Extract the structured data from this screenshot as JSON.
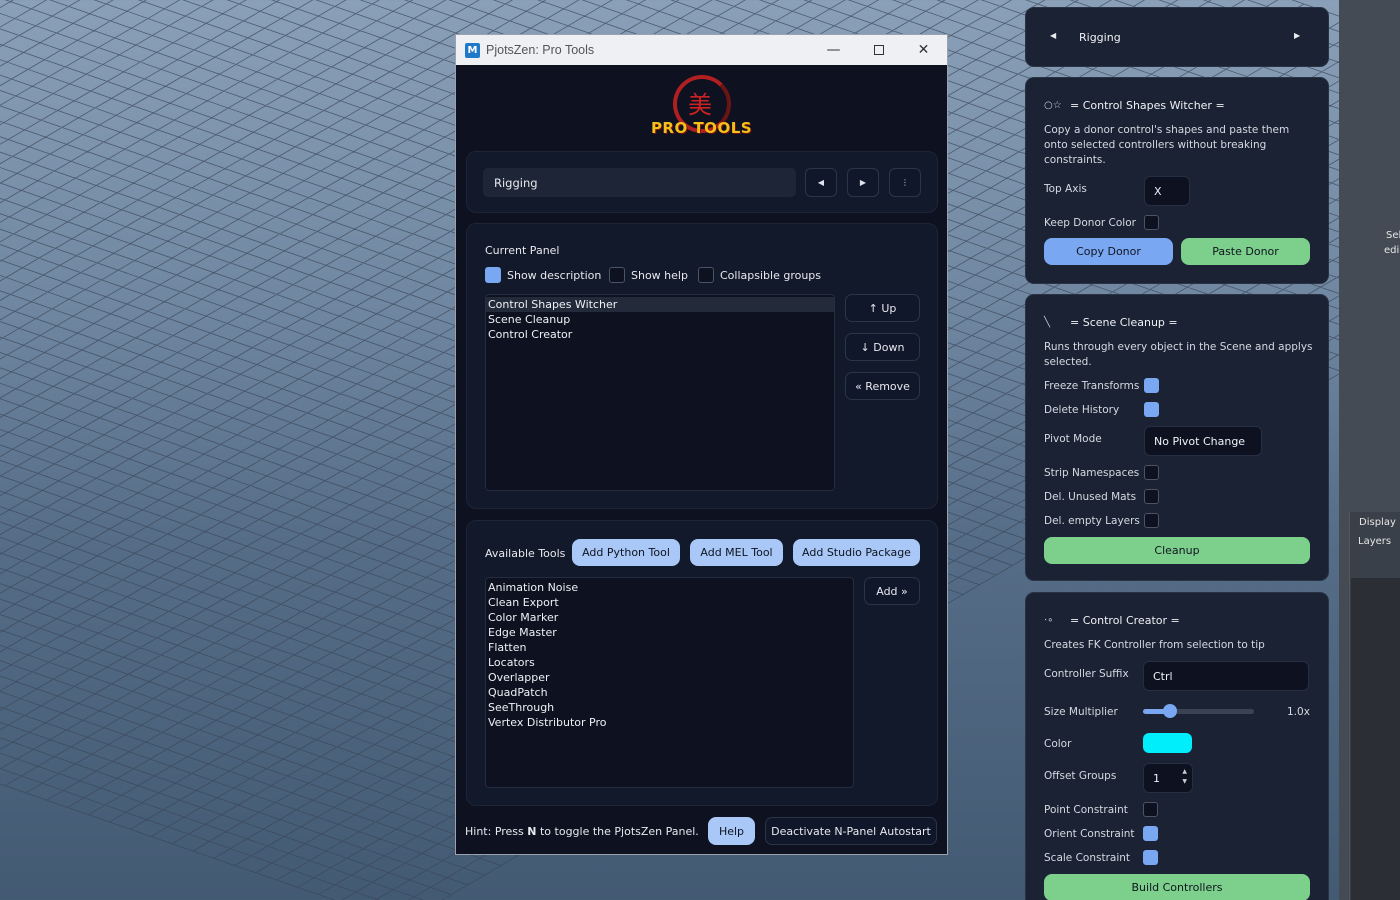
{
  "window": {
    "title": "PjotsZen: Pro Tools",
    "app_icon": "M",
    "logo_text": "PRO TOOLS",
    "logo_glyph": "美"
  },
  "nav": {
    "current": "Rigging"
  },
  "current_panel": {
    "heading": "Current Panel",
    "show_description": {
      "label": "Show description",
      "checked": true
    },
    "show_help": {
      "label": "Show help",
      "checked": false
    },
    "collapsible": {
      "label": "Collapsible groups",
      "checked": false
    },
    "items": [
      "Control Shapes Witcher",
      "Scene Cleanup",
      "Control Creator"
    ],
    "selected": "Control Shapes Witcher",
    "up_label": "↑ Up",
    "down_label": "↓ Down",
    "remove_label": "« Remove"
  },
  "available_tools": {
    "heading": "Available Tools",
    "add_python": "Add Python Tool",
    "add_mel": "Add MEL Tool",
    "add_studio": "Add Studio Package",
    "add_label": "Add »",
    "items": [
      "Animation Noise",
      "Clean Export",
      "Color Marker",
      "Edge Master",
      "Flatten",
      "Locators",
      "Overlapper",
      "QuadPatch",
      "SeeThrough",
      "Vertex Distributor Pro"
    ]
  },
  "footer": {
    "hint_prefix": "Hint: Press ",
    "hint_key": "N",
    "hint_suffix": " to toggle the PjotsZen Panel.",
    "help_label": "Help",
    "deactivate_label": "Deactivate N-Panel Autostart"
  },
  "npanel": {
    "nav_title": "Rigging",
    "csw": {
      "title": "= Control Shapes Witcher =",
      "desc": "Copy a donor control's shapes and paste them onto selected controllers without breaking constraints.",
      "top_axis_label": "Top Axis",
      "top_axis_value": "X",
      "keep_color_label": "Keep Donor Color",
      "copy_label": "Copy Donor",
      "paste_label": "Paste Donor"
    },
    "sc": {
      "title": "= Scene Cleanup =",
      "desc": "Runs through every object in the Scene and applys selected.",
      "freeze": "Freeze Transforms",
      "delete_history": "Delete History",
      "pivot_label": "Pivot Mode",
      "pivot_value": "No Pivot Change",
      "strip_ns": "Strip Namespaces",
      "del_mats": "Del. Unused Mats",
      "del_layers": "Del. empty Layers",
      "cleanup_label": "Cleanup"
    },
    "cc": {
      "title": "= Control Creator =",
      "desc": "Creates FK Controller from selection to tip",
      "suffix_label": "Controller Suffix",
      "suffix_value": "Ctrl",
      "size_label": "Size Multiplier",
      "size_value": "1.0x",
      "size_fraction": 0.24,
      "color_label": "Color",
      "color_value": "#00eefc",
      "offset_label": "Offset Groups",
      "offset_value": "1",
      "point_label": "Point Constraint",
      "orient_label": "Orient Constraint",
      "scale_label": "Scale Constraint",
      "build_label": "Build Controllers"
    }
  },
  "edge": {
    "sel_text": "Sel",
    "edi_text": "edi",
    "display": "Display",
    "layers": "Layers"
  }
}
